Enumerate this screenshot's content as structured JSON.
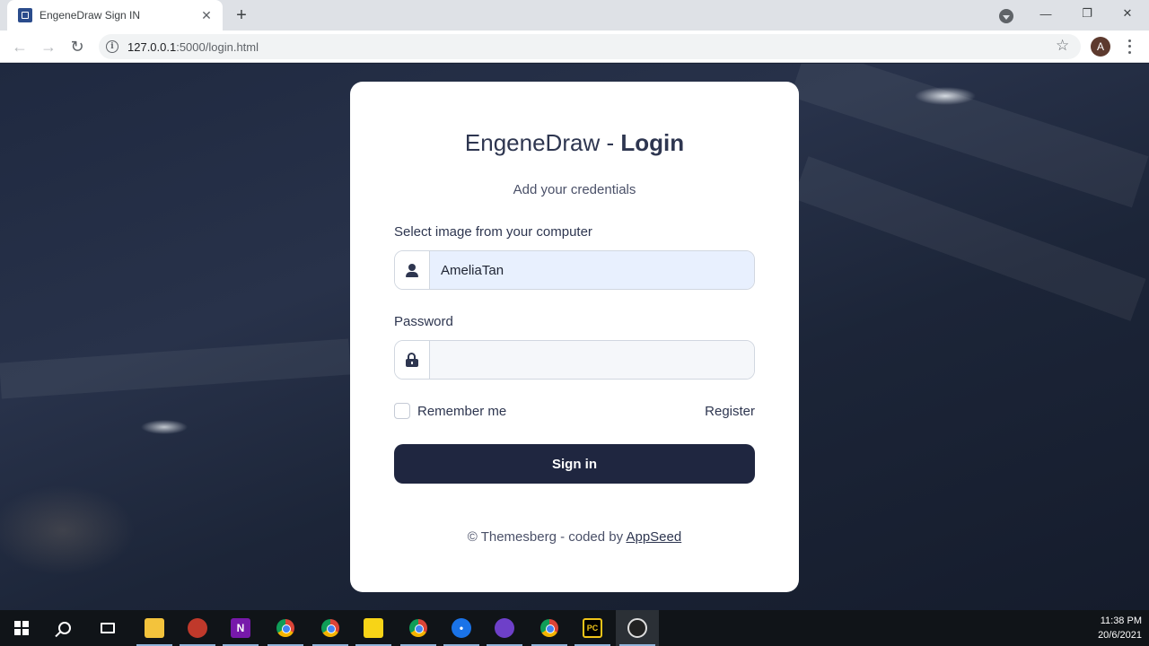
{
  "browser": {
    "tab_title": "EngeneDraw Sign IN",
    "new_tab_icon": "plus-icon",
    "url_host": "127.0.0.1",
    "url_path": ":5000/login.html",
    "profile_initial": "A"
  },
  "login": {
    "title_app": "EngeneDraw",
    "title_separator": " - ",
    "title_page": "Login",
    "subtitle": "Add your credentials",
    "username_label": "Select image from your computer",
    "username_value": "AmeliaTan",
    "password_label": "Password",
    "password_value": "",
    "remember_label": "Remember me",
    "register_label": "Register",
    "signin_label": "Sign in",
    "footer_prefix": "© Themesberg - coded by ",
    "footer_link": "AppSeed"
  },
  "taskbar": {
    "time": "11:38 PM",
    "date": "20/6/2021",
    "apps": [
      "windows-start",
      "search",
      "task-view",
      "file-explorer",
      "snipping-tool",
      "onenote",
      "chrome",
      "chrome-profile",
      "sticky-notes",
      "chrome-2",
      "maps",
      "github-desktop",
      "chrome-3",
      "pycharm",
      "obs"
    ]
  },
  "colors": {
    "card_bg": "#ffffff",
    "primary_button": "#1f2640",
    "autofill_bg": "#e8f0fe",
    "text_dark": "#2e3650"
  }
}
